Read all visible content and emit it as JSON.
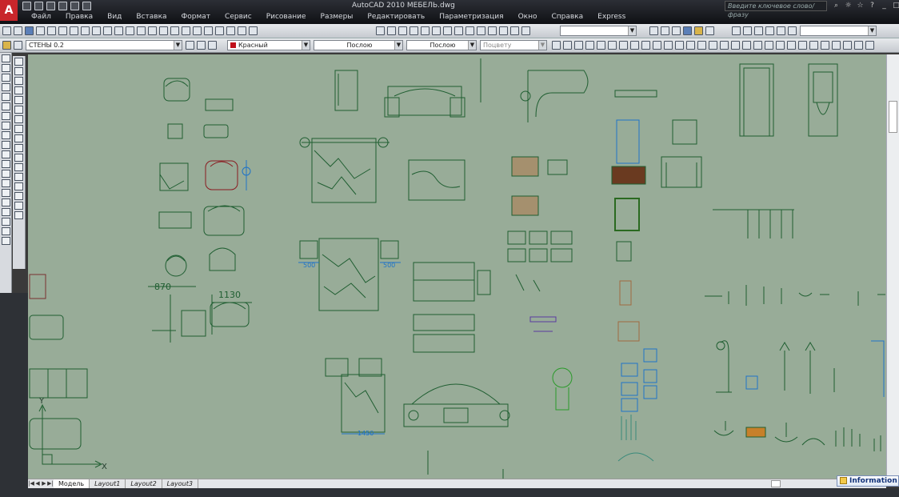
{
  "app": {
    "logo": "A",
    "title": "AutoCAD 2010    МЕБЕЛЬ.dwg"
  },
  "quick_access": [
    "new-icon",
    "open-icon",
    "save-icon",
    "undo-icon",
    "redo-icon",
    "plot-icon"
  ],
  "menu": [
    "Файл",
    "Правка",
    "Вид",
    "Вставка",
    "Формат",
    "Сервис",
    "Рисование",
    "Размеры",
    "Редактировать",
    "Параметризация",
    "Окно",
    "Справка",
    "Express"
  ],
  "help_search": {
    "placeholder": "Введите ключевое слово/фразу"
  },
  "layer": {
    "name": "СТЕНЫ 0.2"
  },
  "properties": {
    "color": "Красный",
    "linetype": "Послою",
    "lineweight": "Послою",
    "plotstyle": "Поцвету"
  },
  "colors": {
    "drawing_bg": "#98ac98",
    "entity": "#1f5e31",
    "dimension": "#1f73c8",
    "accent": "#c0101a"
  },
  "dimensions": {
    "d1": "870",
    "d2": "1130",
    "d3": "500",
    "d4": "500",
    "d5": "1450"
  },
  "ucs": {
    "x": "X",
    "y": "Y"
  },
  "layout_tabs": [
    "Модель",
    "Layout1",
    "Layout2",
    "Layout3"
  ],
  "active_tab": "Модель",
  "info_balloon": "Information"
}
